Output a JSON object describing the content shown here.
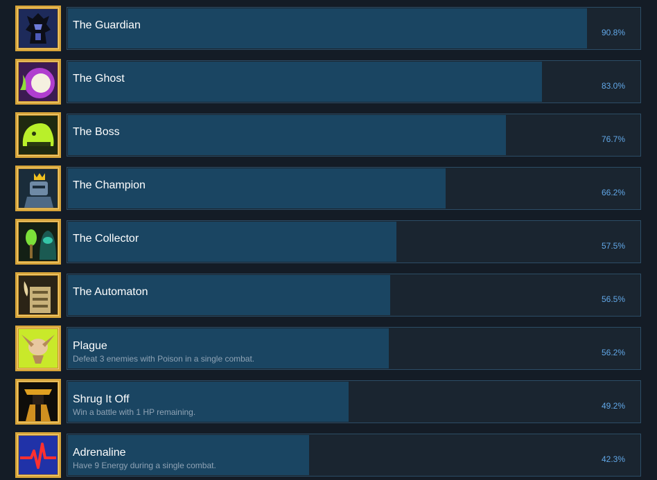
{
  "achievements": [
    {
      "name": "The Guardian",
      "description": "",
      "percent_label": "90.8%",
      "percent": 90.8,
      "icon": "guardian-icon"
    },
    {
      "name": "The Ghost",
      "description": "",
      "percent_label": "83.0%",
      "percent": 83.0,
      "icon": "ghost-icon"
    },
    {
      "name": "The Boss",
      "description": "",
      "percent_label": "76.7%",
      "percent": 76.7,
      "icon": "boss-slime-icon"
    },
    {
      "name": "The Champion",
      "description": "",
      "percent_label": "66.2%",
      "percent": 66.2,
      "icon": "champion-knight-icon"
    },
    {
      "name": "The Collector",
      "description": "",
      "percent_label": "57.5%",
      "percent": 57.5,
      "icon": "collector-icon"
    },
    {
      "name": "The Automaton",
      "description": "",
      "percent_label": "56.5%",
      "percent": 56.5,
      "icon": "automaton-icon"
    },
    {
      "name": "Plague",
      "description": "Defeat 3 enemies with Poison in a single combat.",
      "percent_label": "56.2%",
      "percent": 56.2,
      "icon": "poison-skull-icon"
    },
    {
      "name": "Shrug It Off",
      "description": "Win a battle with 1 HP remaining.",
      "percent_label": "49.2%",
      "percent": 49.2,
      "icon": "warrior-icon"
    },
    {
      "name": "Adrenaline",
      "description": "Have 9 Energy during a single combat.",
      "percent_label": "42.3%",
      "percent": 42.3,
      "icon": "heartbeat-icon"
    }
  ],
  "colors": {
    "background": "#141c26",
    "bar_fill": "#1a4562",
    "bar_border": "#2c4d66",
    "percent_text": "#62a8e8",
    "icon_frame": "#d8a53a"
  }
}
